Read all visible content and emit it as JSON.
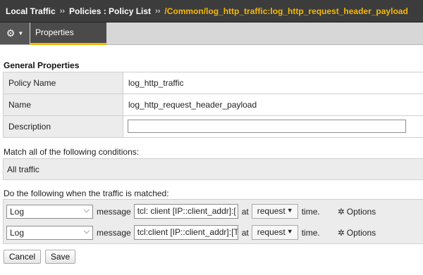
{
  "breadcrumb": {
    "section": "Local Traffic",
    "separator": "››",
    "parent": "Policies : Policy List",
    "current": "/Common/log_http_traffic:log_http_request_header_payload"
  },
  "tabs": {
    "gear_icon": "gear-icon",
    "properties_label": "Properties"
  },
  "general": {
    "title": "General Properties",
    "rows": [
      {
        "label": "Policy Name",
        "value": "log_http_traffic"
      },
      {
        "label": "Name",
        "value": "log_http_request_header_payload"
      },
      {
        "label": "Description",
        "value": ""
      }
    ]
  },
  "conditions": {
    "label": "Match all of the following conditions:",
    "value": "All traffic"
  },
  "actions": {
    "label": "Do the following when the traffic is matched:",
    "rows": [
      {
        "action": "Log",
        "message_word": "message",
        "tcl": "tcl: client [IP::client_addr]:[",
        "at_word": "at",
        "event": "request",
        "time_word": "time.",
        "options_label": "Options"
      },
      {
        "action": "Log",
        "message_word": "message",
        "tcl": "tcl:client [IP::client_addr]:[T",
        "at_word": "at",
        "event": "request",
        "time_word": "time.",
        "options_label": "Options"
      }
    ]
  },
  "buttons": {
    "cancel": "Cancel",
    "save": "Save"
  },
  "colors": {
    "accent": "#f5b800",
    "header_bg": "#3c3c3c",
    "label_bg": "#ececec"
  }
}
